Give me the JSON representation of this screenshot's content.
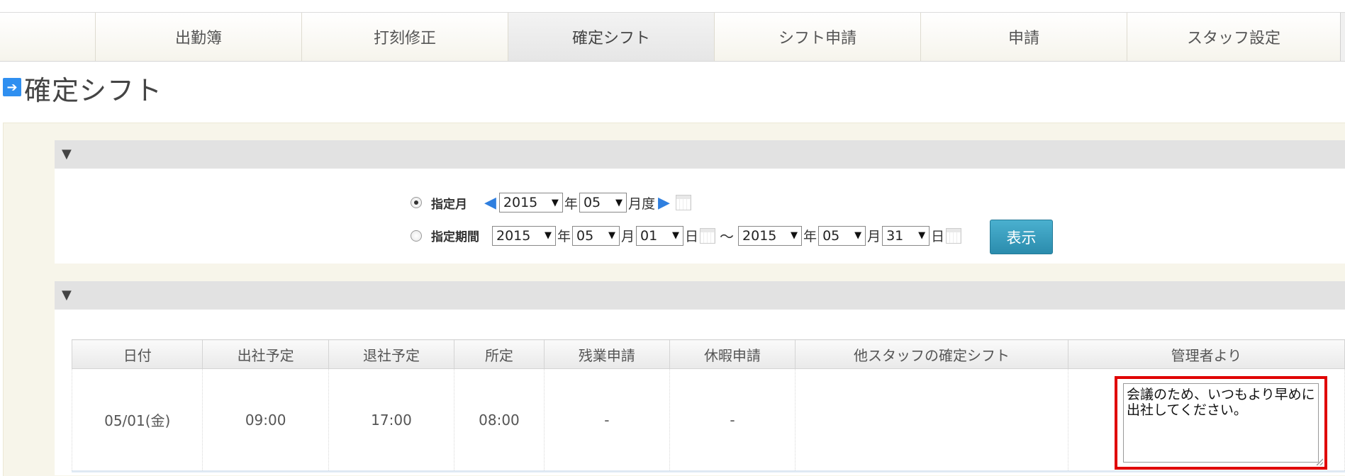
{
  "nav": {
    "items": [
      {
        "label": "出勤簿"
      },
      {
        "label": "打刻修正"
      },
      {
        "label": "確定シフト",
        "active": true
      },
      {
        "label": "シフト申請"
      },
      {
        "label": "申請"
      },
      {
        "label": "スタッフ設定"
      }
    ]
  },
  "page": {
    "title": "確定シフト",
    "title_icon": "arrow-right-icon"
  },
  "filter": {
    "month_mode": {
      "label": "指定月",
      "selected": true,
      "year": "2015",
      "year_unit": "年",
      "month": "05",
      "month_unit": "月度"
    },
    "range_mode": {
      "label": "指定期間",
      "selected": false,
      "from_year": "2015",
      "from_month": "05",
      "from_day": "01",
      "to_year": "2015",
      "to_month": "05",
      "to_day": "31",
      "year_unit": "年",
      "month_unit": "月",
      "day_unit": "日",
      "separator": "～"
    },
    "show_button": "表示"
  },
  "table": {
    "headers": [
      "日付",
      "出社予定",
      "退社予定",
      "所定",
      "残業申請",
      "休暇申請",
      "他スタッフの確定シフト",
      "管理者より"
    ],
    "rows": [
      {
        "date": "05/01(金)",
        "start": "09:00",
        "end": "17:00",
        "scheduled": "08:00",
        "overtime": "-",
        "leave": "-",
        "other_staff": "",
        "manager_note": "会議のため、いつもより早めに出社してください。"
      }
    ]
  },
  "colors": {
    "accent": "#2f8ff0",
    "button": "#3a9ec0",
    "highlight": "#e00000",
    "panel_bg": "#f7f5ea"
  }
}
